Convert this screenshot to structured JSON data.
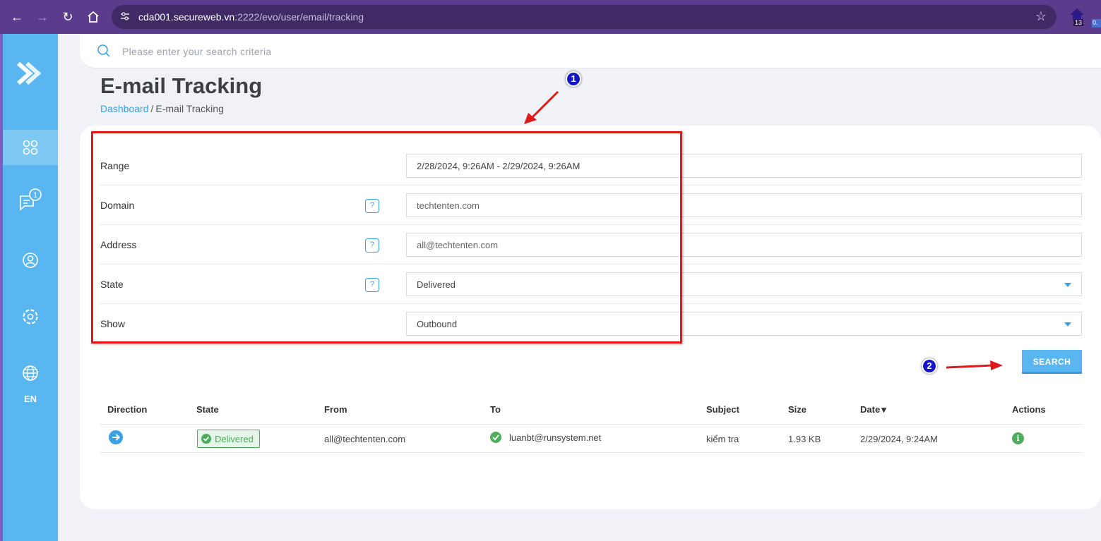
{
  "browser": {
    "url_host": "cda001.secureweb.vn",
    "url_path": ":2222/evo/user/email/tracking",
    "extension_badge": "13",
    "extension_cut_text": "0."
  },
  "sidebar": {
    "language": "EN",
    "notification_count": "1"
  },
  "search": {
    "placeholder": "Please enter your search criteria"
  },
  "page": {
    "title": "E-mail Tracking",
    "breadcrumb_home": "Dashboard",
    "breadcrumb_sep": "/",
    "breadcrumb_current": "E-mail Tracking"
  },
  "form": {
    "range": {
      "label": "Range",
      "value": "2/28/2024, 9:26AM - 2/29/2024, 9:26AM"
    },
    "domain": {
      "label": "Domain",
      "help": "?",
      "value": "techtenten.com"
    },
    "address": {
      "label": "Address",
      "help": "?",
      "value": "all@techtenten.com"
    },
    "state": {
      "label": "State",
      "help": "?",
      "value": "Delivered"
    },
    "show": {
      "label": "Show",
      "value": "Outbound"
    },
    "search_button": "SEARCH"
  },
  "annotations": {
    "marker1": "1",
    "marker2": "2"
  },
  "table": {
    "headers": {
      "direction": "Direction",
      "state": "State",
      "from": "From",
      "to": "To",
      "subject": "Subject",
      "size": "Size",
      "date": "Date",
      "date_sort": "▾",
      "actions": "Actions"
    },
    "rows": [
      {
        "state": "Delivered",
        "from": "all@techtenten.com",
        "to": "luanbt@runsystem.net",
        "subject": "kiểm tra",
        "size": "1.93 KB",
        "date": "2/29/2024, 9:24AM",
        "info": "i"
      }
    ]
  },
  "colors": {
    "browser": "#5b3c8c",
    "sidebar": "#5ab6f0",
    "accent": "#3aa0e6",
    "success": "#4cae5c",
    "annotation_red": "#e01a1a",
    "annotation_marker": "#1515c8"
  }
}
